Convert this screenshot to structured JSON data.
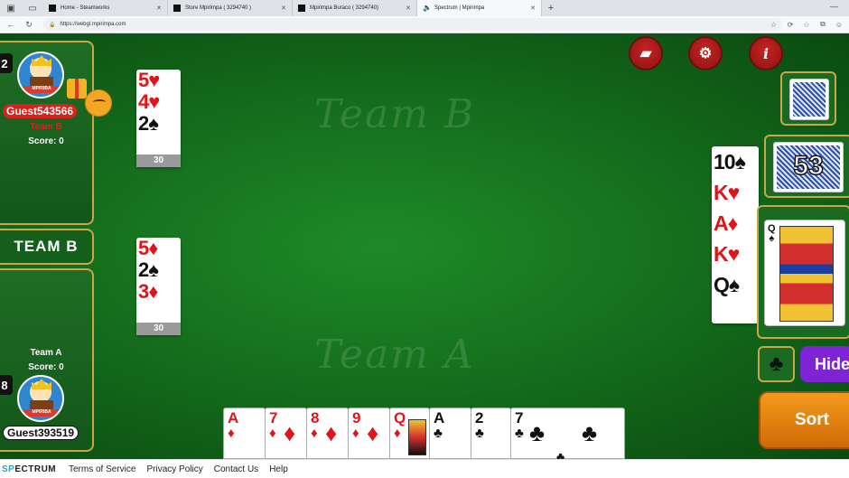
{
  "browser": {
    "tabs": [
      {
        "title": "Home - Steamworks"
      },
      {
        "title": "Store Mpirimpa ( 3294740 )"
      },
      {
        "title": "Mpirimpa Buraco ( 3294740)"
      },
      {
        "title": "Spectrum | Mpirimpa"
      }
    ],
    "url": "https://webgl.mpirimpa.com"
  },
  "game": {
    "watermark_top": "Team B",
    "watermark_bottom": "Team A",
    "top_player": {
      "seat": "2",
      "name": "Guest543566",
      "team": "Team B",
      "score": "Score: 0",
      "avatar_ribbon": "MPIRIBA"
    },
    "team_label": "TEAM B",
    "bottom_player": {
      "seat": "8",
      "name": "Guest393519",
      "team": "Team A",
      "score": "Score: 0",
      "avatar_ribbon": "MPIRIBA"
    },
    "meld_top": {
      "cards": [
        {
          "rank": "5",
          "suit": "♥",
          "color": "red"
        },
        {
          "rank": "4",
          "suit": "♥",
          "color": "red"
        },
        {
          "rank": "2",
          "suit": "♠",
          "color": "black"
        }
      ],
      "points": "30"
    },
    "meld_mid": {
      "cards": [
        {
          "rank": "5",
          "suit": "♦",
          "color": "red"
        },
        {
          "rank": "2",
          "suit": "♠",
          "color": "black"
        },
        {
          "rank": "3",
          "suit": "♦",
          "color": "red"
        }
      ],
      "points": "30"
    },
    "meld_right": {
      "cards": [
        {
          "rank": "10",
          "suit": "♠",
          "color": "black"
        },
        {
          "rank": "K",
          "suit": "♥",
          "color": "red"
        },
        {
          "rank": "A",
          "suit": "♦",
          "color": "red"
        },
        {
          "rank": "K",
          "suit": "♥",
          "color": "red"
        },
        {
          "rank": "Q",
          "suit": "♠",
          "color": "black"
        }
      ]
    },
    "stock_count": "53",
    "discard": {
      "rank": "Q",
      "suit": "♠"
    },
    "suit_button": "♣",
    "hide_label": "Hide",
    "sort_label": "Sort",
    "hand": [
      {
        "rank": "A",
        "suit": "♦",
        "color": "red"
      },
      {
        "rank": "7",
        "suit": "♦",
        "color": "red"
      },
      {
        "rank": "8",
        "suit": "♦",
        "color": "red"
      },
      {
        "rank": "9",
        "suit": "♦",
        "color": "red"
      },
      {
        "rank": "Q",
        "suit": "♦",
        "color": "red"
      },
      {
        "rank": "A",
        "suit": "♣",
        "color": "black"
      },
      {
        "rank": "2",
        "suit": "♣",
        "color": "black"
      },
      {
        "rank": "7",
        "suit": "♣",
        "color": "black"
      }
    ]
  },
  "footer": {
    "logo_a": "SP",
    "logo_b": "ECTRUM",
    "links": [
      "Terms of Service",
      "Privacy Policy",
      "Contact Us",
      "Help"
    ]
  },
  "colors": {
    "felt": "#1f8a29",
    "gold_border": "#c9a648",
    "name_red": "#d8231d",
    "sort_orange": "#f29b1a",
    "hide_purple": "#7f23d6"
  }
}
